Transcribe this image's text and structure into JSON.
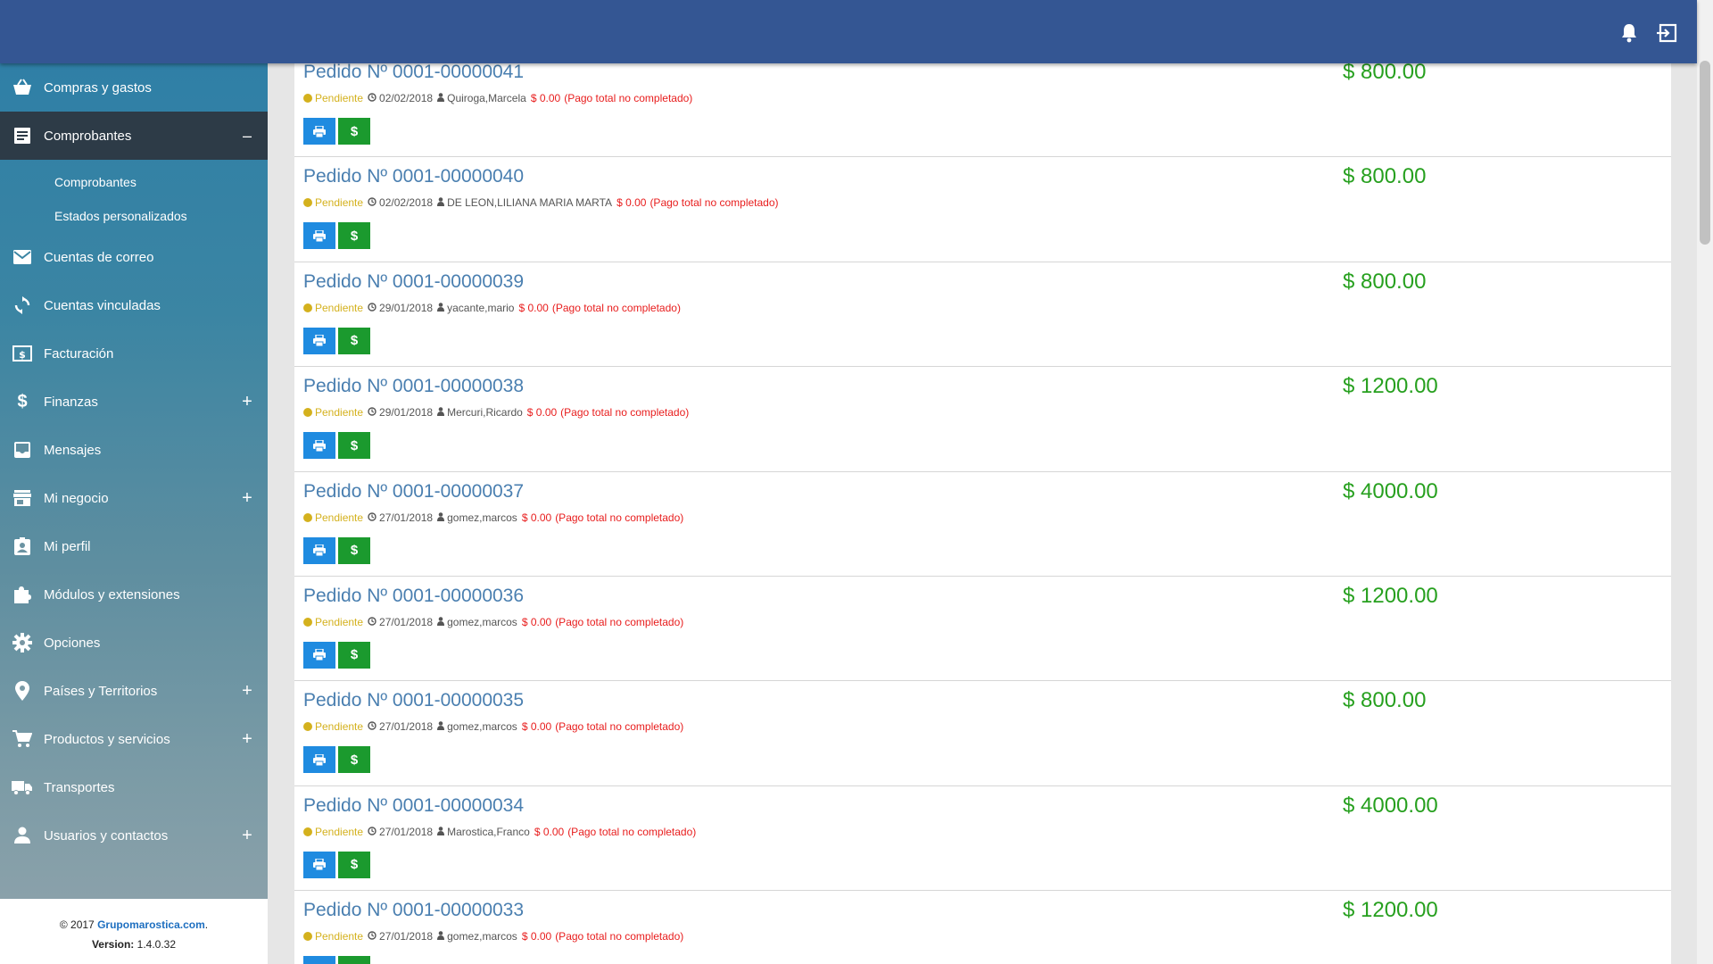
{
  "topbar": {
    "notification_icon": "bell-icon",
    "logout_icon": "logout-icon",
    "color": "#345693"
  },
  "sidebar": {
    "items": [
      {
        "label": "Compras y gastos",
        "icon": "basket-icon",
        "toggle": ""
      },
      {
        "label": "Comprobantes",
        "icon": "receipt-icon",
        "toggle": "–",
        "active": true,
        "children": [
          "Comprobantes",
          "Estados personalizados"
        ]
      },
      {
        "label": "Cuentas de correo",
        "icon": "mail-icon",
        "toggle": ""
      },
      {
        "label": "Cuentas vinculadas",
        "icon": "sync-icon",
        "toggle": ""
      },
      {
        "label": "Facturación",
        "icon": "invoice-icon",
        "toggle": ""
      },
      {
        "label": "Finanzas",
        "icon": "dollar-icon",
        "toggle": "+"
      },
      {
        "label": "Mensajes",
        "icon": "inbox-icon",
        "toggle": ""
      },
      {
        "label": "Mi negocio",
        "icon": "store-icon",
        "toggle": "+"
      },
      {
        "label": "Mi perfil",
        "icon": "profile-icon",
        "toggle": ""
      },
      {
        "label": "Módulos y extensiones",
        "icon": "puzzle-icon",
        "toggle": ""
      },
      {
        "label": "Opciones",
        "icon": "gear-icon",
        "toggle": ""
      },
      {
        "label": "Países y Territorios",
        "icon": "location-icon",
        "toggle": "+"
      },
      {
        "label": "Productos y servicios",
        "icon": "cart-icon",
        "toggle": "+"
      },
      {
        "label": "Transportes",
        "icon": "truck-icon",
        "toggle": ""
      },
      {
        "label": "Usuarios y contactos",
        "icon": "person-icon",
        "toggle": "+"
      }
    ],
    "footer": {
      "copyright": "© 2017 ",
      "company": "Grupomarostica.com",
      "period": ".",
      "version_label": "Version:",
      "version": " 1.4.0.32"
    }
  },
  "orders": [
    {
      "title": "Pedido Nº 0001-00000041",
      "status": "Pendiente",
      "date": "02/02/2018",
      "customer": "Quiroga,Marcela",
      "paid": "$ 0.00",
      "note": "(Pago total no completado)",
      "amount": "$ 800.00"
    },
    {
      "title": "Pedido Nº 0001-00000040",
      "status": "Pendiente",
      "date": "02/02/2018",
      "customer": "DE LEON,LILIANA MARIA MARTA",
      "paid": "$ 0.00",
      "note": "(Pago total no completado)",
      "amount": "$ 800.00"
    },
    {
      "title": "Pedido Nº 0001-00000039",
      "status": "Pendiente",
      "date": "29/01/2018",
      "customer": "yacante,mario",
      "paid": "$ 0.00",
      "note": "(Pago total no completado)",
      "amount": "$ 800.00"
    },
    {
      "title": "Pedido Nº 0001-00000038",
      "status": "Pendiente",
      "date": "29/01/2018",
      "customer": "Mercuri,Ricardo",
      "paid": "$ 0.00",
      "note": "(Pago total no completado)",
      "amount": "$ 1200.00"
    },
    {
      "title": "Pedido Nº 0001-00000037",
      "status": "Pendiente",
      "date": "27/01/2018",
      "customer": "gomez,marcos",
      "paid": "$ 0.00",
      "note": "(Pago total no completado)",
      "amount": "$ 4000.00"
    },
    {
      "title": "Pedido Nº 0001-00000036",
      "status": "Pendiente",
      "date": "27/01/2018",
      "customer": "gomez,marcos",
      "paid": "$ 0.00",
      "note": "(Pago total no completado)",
      "amount": "$ 1200.00"
    },
    {
      "title": "Pedido Nº 0001-00000035",
      "status": "Pendiente",
      "date": "27/01/2018",
      "customer": "gomez,marcos",
      "paid": "$ 0.00",
      "note": "(Pago total no completado)",
      "amount": "$ 800.00"
    },
    {
      "title": "Pedido Nº 0001-00000034",
      "status": "Pendiente",
      "date": "27/01/2018",
      "customer": "Marostica,Franco",
      "paid": "$ 0.00",
      "note": "(Pago total no completado)",
      "amount": "$ 4000.00"
    },
    {
      "title": "Pedido Nº 0001-00000033",
      "status": "Pendiente",
      "date": "27/01/2018",
      "customer": "gomez,marcos",
      "paid": "$ 0.00",
      "note": "(Pago total no completado)",
      "amount": "$ 1200.00"
    }
  ],
  "colors": {
    "status_pending": "#d4b11d",
    "amount": "#27a01f",
    "unpaid": "#e81d1d",
    "print_button": "#1f8be0",
    "pay_button": "#1b9a2e",
    "order_title": "#4a7fb0"
  }
}
